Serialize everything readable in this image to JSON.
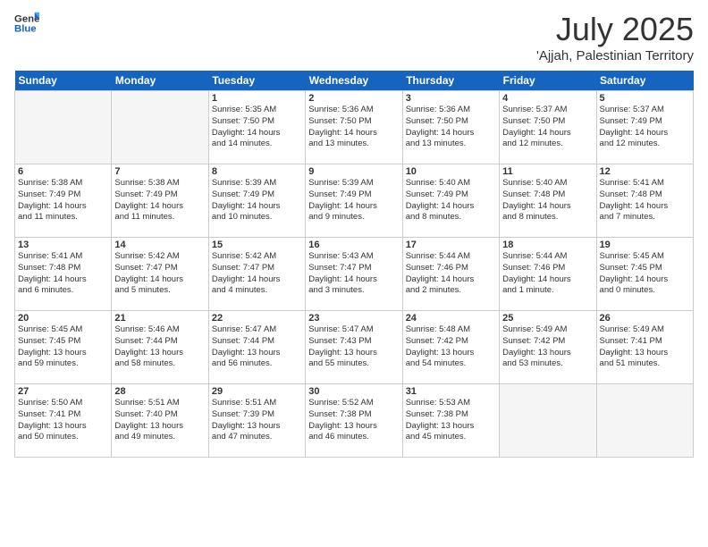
{
  "logo": {
    "general": "General",
    "blue": "Blue"
  },
  "title": "July 2025",
  "location": "'Ajjah, Palestinian Territory",
  "days_header": [
    "Sunday",
    "Monday",
    "Tuesday",
    "Wednesday",
    "Thursday",
    "Friday",
    "Saturday"
  ],
  "weeks": [
    [
      {
        "day": "",
        "lines": []
      },
      {
        "day": "",
        "lines": []
      },
      {
        "day": "1",
        "lines": [
          "Sunrise: 5:35 AM",
          "Sunset: 7:50 PM",
          "Daylight: 14 hours",
          "and 14 minutes."
        ]
      },
      {
        "day": "2",
        "lines": [
          "Sunrise: 5:36 AM",
          "Sunset: 7:50 PM",
          "Daylight: 14 hours",
          "and 13 minutes."
        ]
      },
      {
        "day": "3",
        "lines": [
          "Sunrise: 5:36 AM",
          "Sunset: 7:50 PM",
          "Daylight: 14 hours",
          "and 13 minutes."
        ]
      },
      {
        "day": "4",
        "lines": [
          "Sunrise: 5:37 AM",
          "Sunset: 7:50 PM",
          "Daylight: 14 hours",
          "and 12 minutes."
        ]
      },
      {
        "day": "5",
        "lines": [
          "Sunrise: 5:37 AM",
          "Sunset: 7:49 PM",
          "Daylight: 14 hours",
          "and 12 minutes."
        ]
      }
    ],
    [
      {
        "day": "6",
        "lines": [
          "Sunrise: 5:38 AM",
          "Sunset: 7:49 PM",
          "Daylight: 14 hours",
          "and 11 minutes."
        ]
      },
      {
        "day": "7",
        "lines": [
          "Sunrise: 5:38 AM",
          "Sunset: 7:49 PM",
          "Daylight: 14 hours",
          "and 11 minutes."
        ]
      },
      {
        "day": "8",
        "lines": [
          "Sunrise: 5:39 AM",
          "Sunset: 7:49 PM",
          "Daylight: 14 hours",
          "and 10 minutes."
        ]
      },
      {
        "day": "9",
        "lines": [
          "Sunrise: 5:39 AM",
          "Sunset: 7:49 PM",
          "Daylight: 14 hours",
          "and 9 minutes."
        ]
      },
      {
        "day": "10",
        "lines": [
          "Sunrise: 5:40 AM",
          "Sunset: 7:49 PM",
          "Daylight: 14 hours",
          "and 8 minutes."
        ]
      },
      {
        "day": "11",
        "lines": [
          "Sunrise: 5:40 AM",
          "Sunset: 7:48 PM",
          "Daylight: 14 hours",
          "and 8 minutes."
        ]
      },
      {
        "day": "12",
        "lines": [
          "Sunrise: 5:41 AM",
          "Sunset: 7:48 PM",
          "Daylight: 14 hours",
          "and 7 minutes."
        ]
      }
    ],
    [
      {
        "day": "13",
        "lines": [
          "Sunrise: 5:41 AM",
          "Sunset: 7:48 PM",
          "Daylight: 14 hours",
          "and 6 minutes."
        ]
      },
      {
        "day": "14",
        "lines": [
          "Sunrise: 5:42 AM",
          "Sunset: 7:47 PM",
          "Daylight: 14 hours",
          "and 5 minutes."
        ]
      },
      {
        "day": "15",
        "lines": [
          "Sunrise: 5:42 AM",
          "Sunset: 7:47 PM",
          "Daylight: 14 hours",
          "and 4 minutes."
        ]
      },
      {
        "day": "16",
        "lines": [
          "Sunrise: 5:43 AM",
          "Sunset: 7:47 PM",
          "Daylight: 14 hours",
          "and 3 minutes."
        ]
      },
      {
        "day": "17",
        "lines": [
          "Sunrise: 5:44 AM",
          "Sunset: 7:46 PM",
          "Daylight: 14 hours",
          "and 2 minutes."
        ]
      },
      {
        "day": "18",
        "lines": [
          "Sunrise: 5:44 AM",
          "Sunset: 7:46 PM",
          "Daylight: 14 hours",
          "and 1 minute."
        ]
      },
      {
        "day": "19",
        "lines": [
          "Sunrise: 5:45 AM",
          "Sunset: 7:45 PM",
          "Daylight: 14 hours",
          "and 0 minutes."
        ]
      }
    ],
    [
      {
        "day": "20",
        "lines": [
          "Sunrise: 5:45 AM",
          "Sunset: 7:45 PM",
          "Daylight: 13 hours",
          "and 59 minutes."
        ]
      },
      {
        "day": "21",
        "lines": [
          "Sunrise: 5:46 AM",
          "Sunset: 7:44 PM",
          "Daylight: 13 hours",
          "and 58 minutes."
        ]
      },
      {
        "day": "22",
        "lines": [
          "Sunrise: 5:47 AM",
          "Sunset: 7:44 PM",
          "Daylight: 13 hours",
          "and 56 minutes."
        ]
      },
      {
        "day": "23",
        "lines": [
          "Sunrise: 5:47 AM",
          "Sunset: 7:43 PM",
          "Daylight: 13 hours",
          "and 55 minutes."
        ]
      },
      {
        "day": "24",
        "lines": [
          "Sunrise: 5:48 AM",
          "Sunset: 7:42 PM",
          "Daylight: 13 hours",
          "and 54 minutes."
        ]
      },
      {
        "day": "25",
        "lines": [
          "Sunrise: 5:49 AM",
          "Sunset: 7:42 PM",
          "Daylight: 13 hours",
          "and 53 minutes."
        ]
      },
      {
        "day": "26",
        "lines": [
          "Sunrise: 5:49 AM",
          "Sunset: 7:41 PM",
          "Daylight: 13 hours",
          "and 51 minutes."
        ]
      }
    ],
    [
      {
        "day": "27",
        "lines": [
          "Sunrise: 5:50 AM",
          "Sunset: 7:41 PM",
          "Daylight: 13 hours",
          "and 50 minutes."
        ]
      },
      {
        "day": "28",
        "lines": [
          "Sunrise: 5:51 AM",
          "Sunset: 7:40 PM",
          "Daylight: 13 hours",
          "and 49 minutes."
        ]
      },
      {
        "day": "29",
        "lines": [
          "Sunrise: 5:51 AM",
          "Sunset: 7:39 PM",
          "Daylight: 13 hours",
          "and 47 minutes."
        ]
      },
      {
        "day": "30",
        "lines": [
          "Sunrise: 5:52 AM",
          "Sunset: 7:38 PM",
          "Daylight: 13 hours",
          "and 46 minutes."
        ]
      },
      {
        "day": "31",
        "lines": [
          "Sunrise: 5:53 AM",
          "Sunset: 7:38 PM",
          "Daylight: 13 hours",
          "and 45 minutes."
        ]
      },
      {
        "day": "",
        "lines": []
      },
      {
        "day": "",
        "lines": []
      }
    ]
  ]
}
